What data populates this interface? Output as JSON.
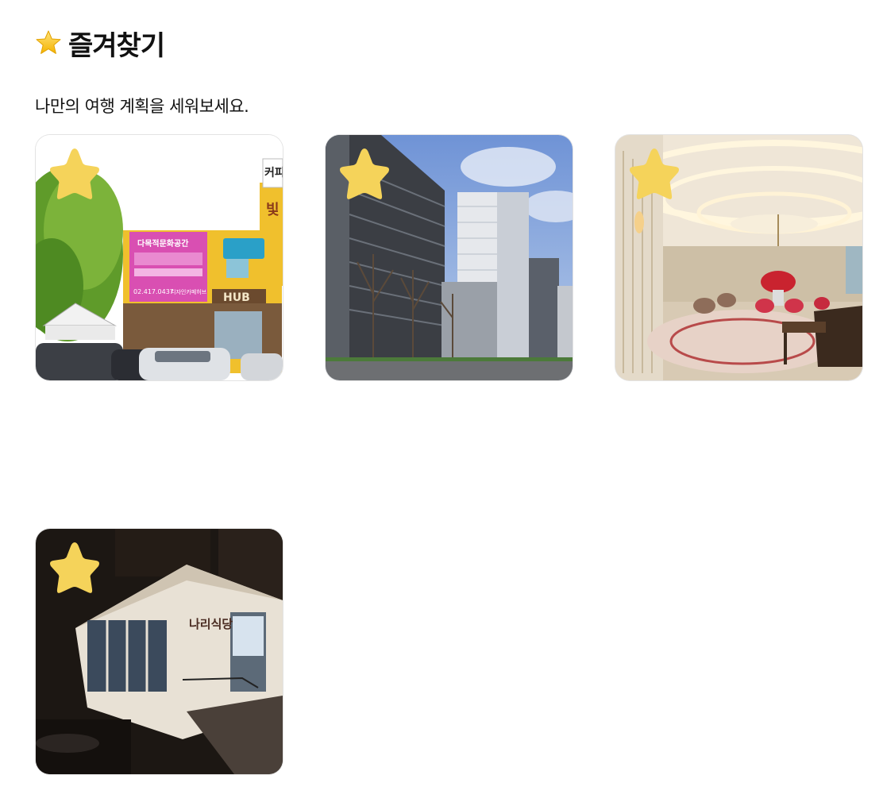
{
  "header": {
    "icon": "star-emoji-icon",
    "title": "즐겨찾기"
  },
  "subtitle": "나만의 여행 계획을 세워보세요.",
  "favorites": [
    {
      "scene": "yellow-cafe-storefront",
      "sign_banner": "다목적문화공간",
      "sign_phone": "02.417.0437",
      "sign_extra": "디자인카페허브",
      "sign_hub": "HUB",
      "sign_top": "커피",
      "sign_side": "빛",
      "favorited": true
    },
    {
      "scene": "city-office-towers",
      "favorited": true
    },
    {
      "scene": "hotel-lobby-interior",
      "favorited": true
    },
    {
      "scene": "night-restaurant-exterior",
      "sign": "나리식당",
      "favorited": true
    }
  ],
  "colors": {
    "star": "#F5D35A",
    "text": "#111111"
  }
}
